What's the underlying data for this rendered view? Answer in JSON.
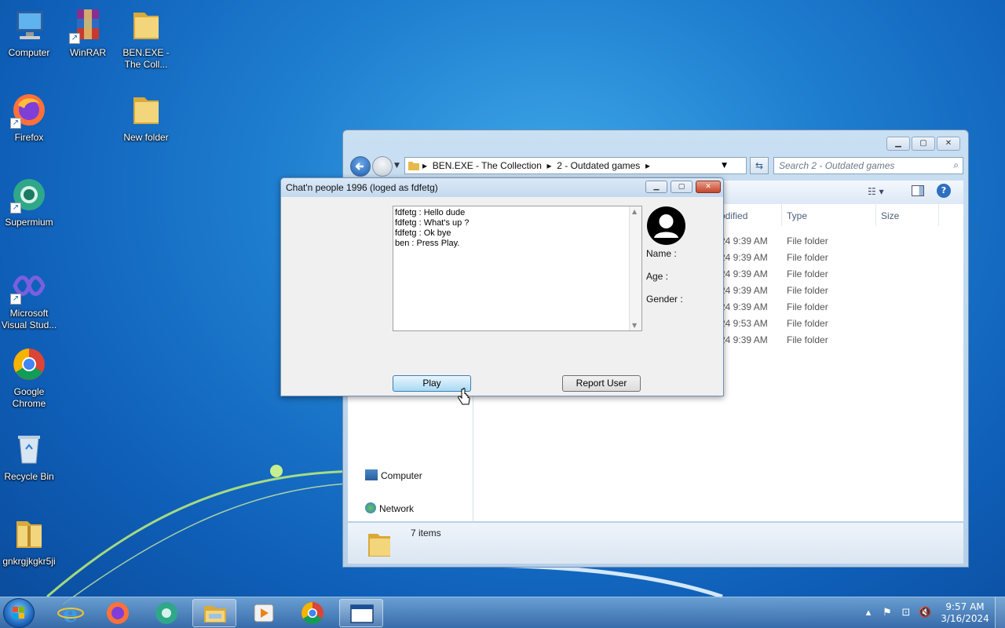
{
  "desktop": {
    "icons": [
      {
        "label": "Computer"
      },
      {
        "label": "WinRAR"
      },
      {
        "label": "BEN.EXE - The Coll..."
      },
      {
        "label": "Firefox"
      },
      {
        "label": "New folder"
      },
      {
        "label": "Supermium"
      },
      {
        "label": "Microsoft Visual Stud..."
      },
      {
        "label": "Google Chrome"
      },
      {
        "label": "Recycle Bin"
      },
      {
        "label": "gnkrgjkgkr5ji"
      }
    ]
  },
  "explorer": {
    "breadcrumb": [
      "BEN.EXE - The Collection",
      "2 - Outdated games"
    ],
    "search_placeholder": "Search 2 - Outdated games",
    "columns": {
      "modified": "odified",
      "type": "Type",
      "size": "Size"
    },
    "rows": [
      {
        "date": "24 9:39 AM",
        "type": "File folder"
      },
      {
        "date": "24 9:39 AM",
        "type": "File folder"
      },
      {
        "date": "24 9:39 AM",
        "type": "File folder"
      },
      {
        "date": "24 9:39 AM",
        "type": "File folder"
      },
      {
        "date": "24 9:39 AM",
        "type": "File folder"
      },
      {
        "date": "24 9:53 AM",
        "type": "File folder"
      },
      {
        "date": "24 9:39 AM",
        "type": "File folder"
      }
    ],
    "nav": {
      "computer": "Computer",
      "network": "Network"
    },
    "status": "7 items"
  },
  "chat": {
    "title": "Chat'n people 1996 (loged as fdfetg)",
    "messages": [
      "fdfetg : Hello dude",
      "fdfetg : What's up ?",
      "fdfetg : Ok bye",
      "ben : Press Play."
    ],
    "profile": {
      "name_label": "Name :",
      "age_label": "Age :",
      "gender_label": "Gender :"
    },
    "play_label": "Play",
    "report_label": "Report User"
  },
  "taskbar": {
    "time": "9:57 AM",
    "date": "3/16/2024"
  },
  "colors": {
    "accent": "#1f7fd0",
    "folder": "#e9c25a",
    "close_red": "#c5452c"
  }
}
